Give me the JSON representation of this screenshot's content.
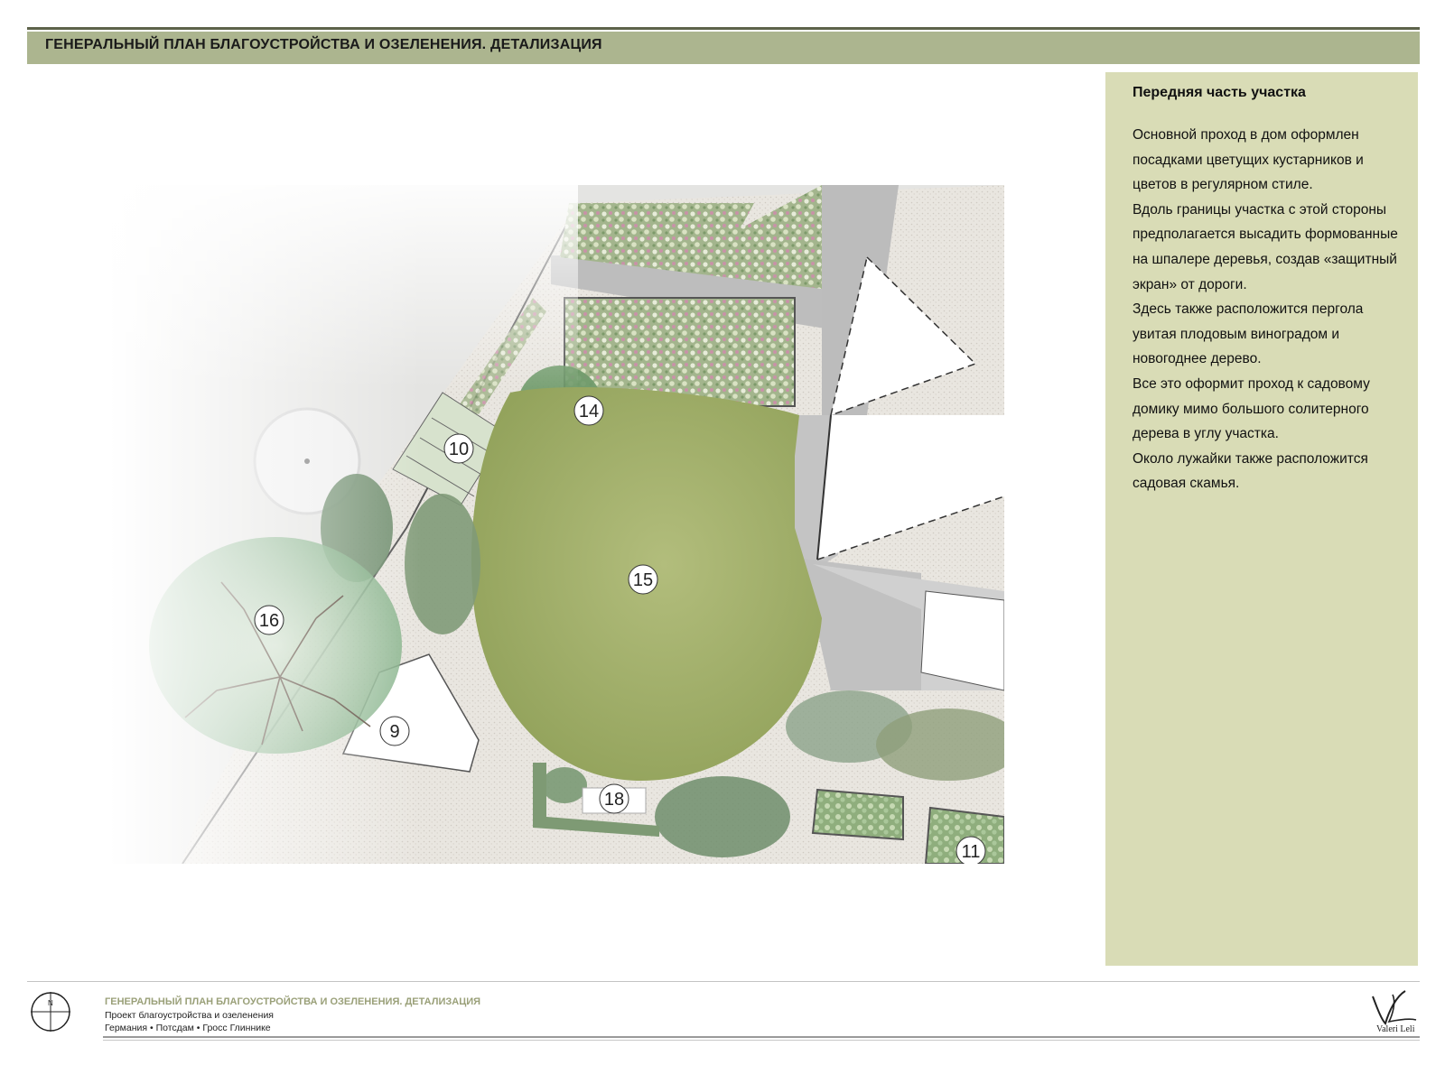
{
  "header": {
    "title": "ГЕНЕРАЛЬНЫЙ ПЛАН БЛАГОУСТРОЙСТВА И ОЗЕЛЕНЕНИЯ. ДЕТАЛИЗАЦИЯ"
  },
  "plan": {
    "markers": [
      {
        "label": "14"
      },
      {
        "label": "10"
      },
      {
        "label": "15"
      },
      {
        "label": "16"
      },
      {
        "label": "9"
      },
      {
        "label": "18"
      },
      {
        "label": "11"
      }
    ]
  },
  "side_panel": {
    "title": "Передняя часть участка",
    "paragraphs": [
      "Основной проход в дом оформлен посадками цветущих кустарников и цветов в регулярном стиле.",
      "Вдоль границы участка с этой стороны предполагается высадить формованные на шпалере деревья, создав «защитный экран» от дороги.",
      "Здесь также расположится пергола увитая плодовым виноградом и новогоднее дерево.",
      "Все это оформит проход к садовому домику мимо большого солитерного дерева в углу участка.",
      "Около лужайки также расположится садовая скамья."
    ]
  },
  "footer": {
    "title": "ГЕНЕРАЛЬНЫЙ ПЛАН БЛАГОУСТРОЙСТВА И ОЗЕЛЕНЕНИЯ. ДЕТАЛИЗАЦИЯ",
    "subtitle": "Проект благоустройства и озеленения",
    "location": "Германия  •  Потсдам  •  Гросс Глинникe",
    "compass_label": "N",
    "logo_text": "Valeri Leli"
  },
  "colors": {
    "header_band": "#acb58f",
    "side_panel": "#d9dcb6",
    "lawn": "#a7b46e",
    "paving": "#b9b9b9",
    "footer_title": "#9aa079"
  }
}
